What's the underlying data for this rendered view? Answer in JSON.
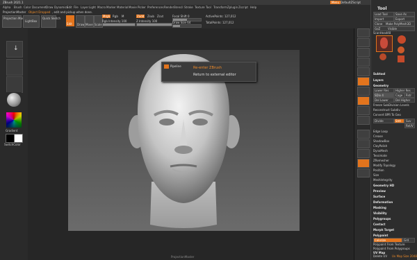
{
  "window": {
    "title": "ZBrush 2021.1",
    "menu_label": "Menu",
    "default_script": "DefaultZScript"
  },
  "menubar": [
    "Alpha",
    "Brush",
    "Color",
    "Document",
    "Draw",
    "Dynamics",
    "Edit",
    "File",
    "Layer",
    "Light",
    "Macro",
    "Marker",
    "Material",
    "Movie",
    "Picker",
    "Preferences",
    "Render",
    "Stencil",
    "Stroke",
    "Texture",
    "Tool",
    "Transform",
    "Zplugin",
    "Zscript",
    "Help"
  ],
  "toolbar": {
    "hint_prefix": "ProjectionMaster",
    "hint_highlight": "Object Dropped",
    "hint_suffix": ", edit and pickup when done.",
    "buttons": [
      "Projection Master",
      "LightBox",
      "Quick Sketch"
    ],
    "edit": "Edit",
    "draw": "Draw",
    "move": "Move",
    "scale": "Scale",
    "rotate": "Rotate",
    "mrgb": "Mrgb",
    "rgb": "Rgb",
    "m": "M",
    "rgb_intensity": "Rgb Intensity 100",
    "zadd": "Zadd",
    "zsub": "Zsub",
    "zcut": "Zcut",
    "z_intensity": "Z Intensity 100",
    "focal_shift": "Focal Shift 0",
    "draw_size": "Draw Size 64",
    "active_points": "ActivePoints: 127,012",
    "total_points": "TotalPoints: 127,012"
  },
  "left_shelf": {
    "gradient_label": "Gradient",
    "switch_color_label": "SwitchColor"
  },
  "context_menu": {
    "icon_label": "Pipeline",
    "items": [
      "Re-enter ZBrush",
      "Return to external editor"
    ]
  },
  "right_tray": {
    "tool_title": "Tool",
    "buttons_row1": [
      "Load Tool",
      "Save As"
    ],
    "buttons_row2": [
      "Import",
      "Export"
    ],
    "buttons_row3": [
      "Clone",
      "Make PolyMesh3D"
    ],
    "goz": "GoZ",
    "all_visible": "Visible",
    "current_tool": "ScanHead48",
    "thumbs": [
      "ScanHead48",
      "Cube3D",
      "Sphere3D",
      "Cylinder3D",
      "PolyMesh3D"
    ],
    "sections": [
      "Subtool",
      "Layers"
    ],
    "geometry": {
      "title": "Geometry",
      "lower_res": "Lower Res",
      "higher_res": "Higher Res",
      "sdiv": "SDiv 4",
      "cage": "Cage",
      "rstr": "Rstr",
      "del_lower": "Del Lower",
      "del_higher": "Del Higher",
      "freeze": "Freeze SubDivision Levels",
      "reconstruct": "Reconstruct Subdiv",
      "convert_bpr": "Convert BPR To Geo",
      "divide": "Divide",
      "smt": "Smt",
      "suv": "Suv",
      "reuv": "ReUV",
      "edge_loop": "Edge Loop",
      "crease": "Crease",
      "shadowbox": "ShadowBox",
      "clay_polish": "ClayPolish",
      "dynamesh": "DynaMesh",
      "tessimate": "Tessimate",
      "zremesher": "ZRemesher",
      "modify_topology": "Modify Topology",
      "position": "Position",
      "size": "Size",
      "meshintegrity": "MeshIntegrity"
    },
    "more_sections": [
      "Geometry HD",
      "Preview",
      "Surface",
      "Deformation",
      "Masking",
      "Visibility",
      "Polygroups",
      "Contact",
      "Morph Target",
      "Polypaint"
    ],
    "polypaint": {
      "colorize": "Colorize",
      "grd": "Grd",
      "from_texture": "Polypaint From Texture",
      "from_polygroups": "Polypaint From Polygroups"
    },
    "uv_map": "UV Map",
    "delete_uv": "Delete UV",
    "uv_size": "Uv Map Size 2048"
  },
  "footer": {
    "canvas_hint": "ProjectionMaster"
  }
}
